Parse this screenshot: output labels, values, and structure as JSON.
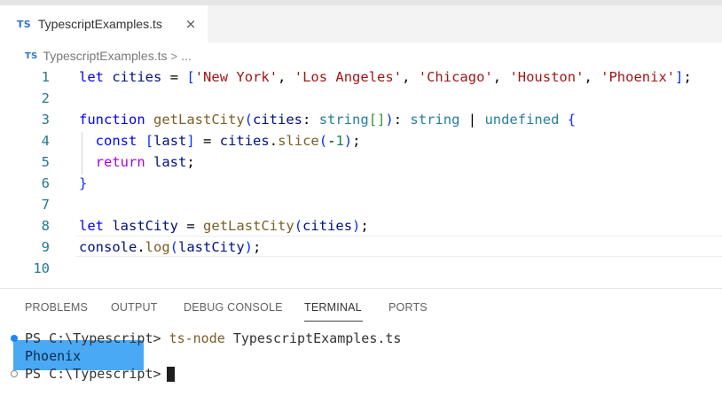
{
  "tab": {
    "badge": "TS",
    "title": "TypescriptExamples.ts",
    "close_icon": "×"
  },
  "breadcrumb": {
    "badge": "TS",
    "file": "TypescriptExamples.ts",
    "separator": ">",
    "more": "..."
  },
  "editor": {
    "line_numbers": [
      "1",
      "2",
      "3",
      "4",
      "5",
      "6",
      "7",
      "8",
      "9",
      "10"
    ],
    "lines": [
      "let cities = ['New York', 'Los Angeles', 'Chicago', 'Houston', 'Phoenix'];",
      "",
      "function getLastCity(cities: string[]): string | undefined {",
      "  const [last] = cities.slice(-1);",
      "  return last;",
      "}",
      "",
      "let lastCity = getLastCity(cities);",
      "console.log(lastCity);",
      ""
    ]
  },
  "panel": {
    "tabs": [
      "PROBLEMS",
      "OUTPUT",
      "DEBUG CONSOLE",
      "TERMINAL",
      "PORTS"
    ],
    "active_tab": "TERMINAL"
  },
  "terminal": {
    "line1_prompt": "PS C:\\Typescript>",
    "line1_command": "ts-node",
    "line1_args": "TypescriptExamples.ts",
    "output": "Phoenix",
    "line3_prompt": "PS C:\\Typescript>"
  },
  "colors": {
    "accent": "#1a85ff",
    "selection": "#4aa9f4",
    "keyword": "#0000ff",
    "string": "#a31515",
    "type": "#267f99",
    "function": "#795e26"
  }
}
